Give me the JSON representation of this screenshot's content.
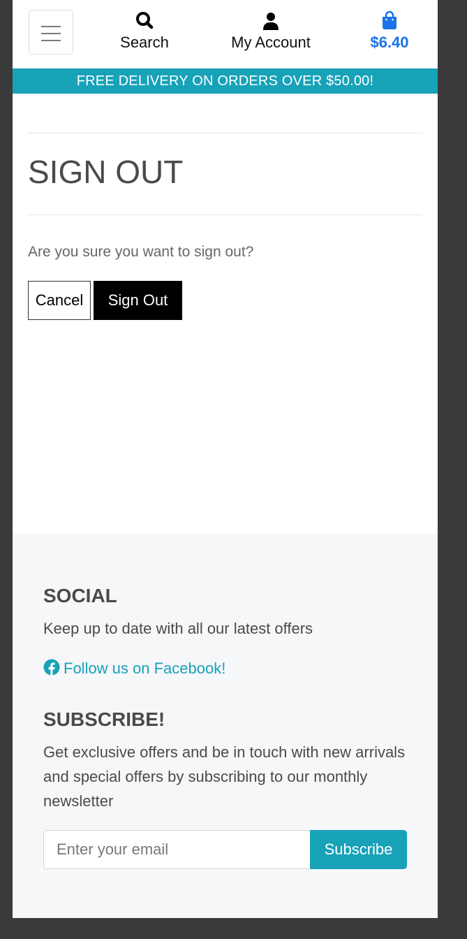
{
  "header": {
    "menu_icon": "hamburger-menu-icon",
    "search": {
      "icon": "search-icon",
      "label": "Search"
    },
    "account": {
      "icon": "user-icon",
      "label": "My Account"
    },
    "bag": {
      "icon": "shopping-bag-icon",
      "total": "$6.40",
      "color": "#1a73e8"
    }
  },
  "banner": {
    "text": "FREE DELIVERY ON ORDERS OVER $50.00!",
    "color": "#17a2b8"
  },
  "main": {
    "title": "SIGN OUT",
    "question": "Are you sure you want to sign out?",
    "cancel_label": "Cancel",
    "signout_label": "Sign Out"
  },
  "footer": {
    "social_heading": "SOCIAL",
    "social_text": "Keep up to date with all our latest offers",
    "facebook_icon": "facebook-icon",
    "facebook_link": "Follow us on Facebook!",
    "subscribe_heading": "SUBSCRIBE!",
    "subscribe_text": "Get exclusive offers and be in touch with new arrivals and special offers by subscribing to our monthly newsletter",
    "email_placeholder": "Enter your email",
    "subscribe_label": "Subscribe",
    "accent_color": "#17a2b8"
  }
}
